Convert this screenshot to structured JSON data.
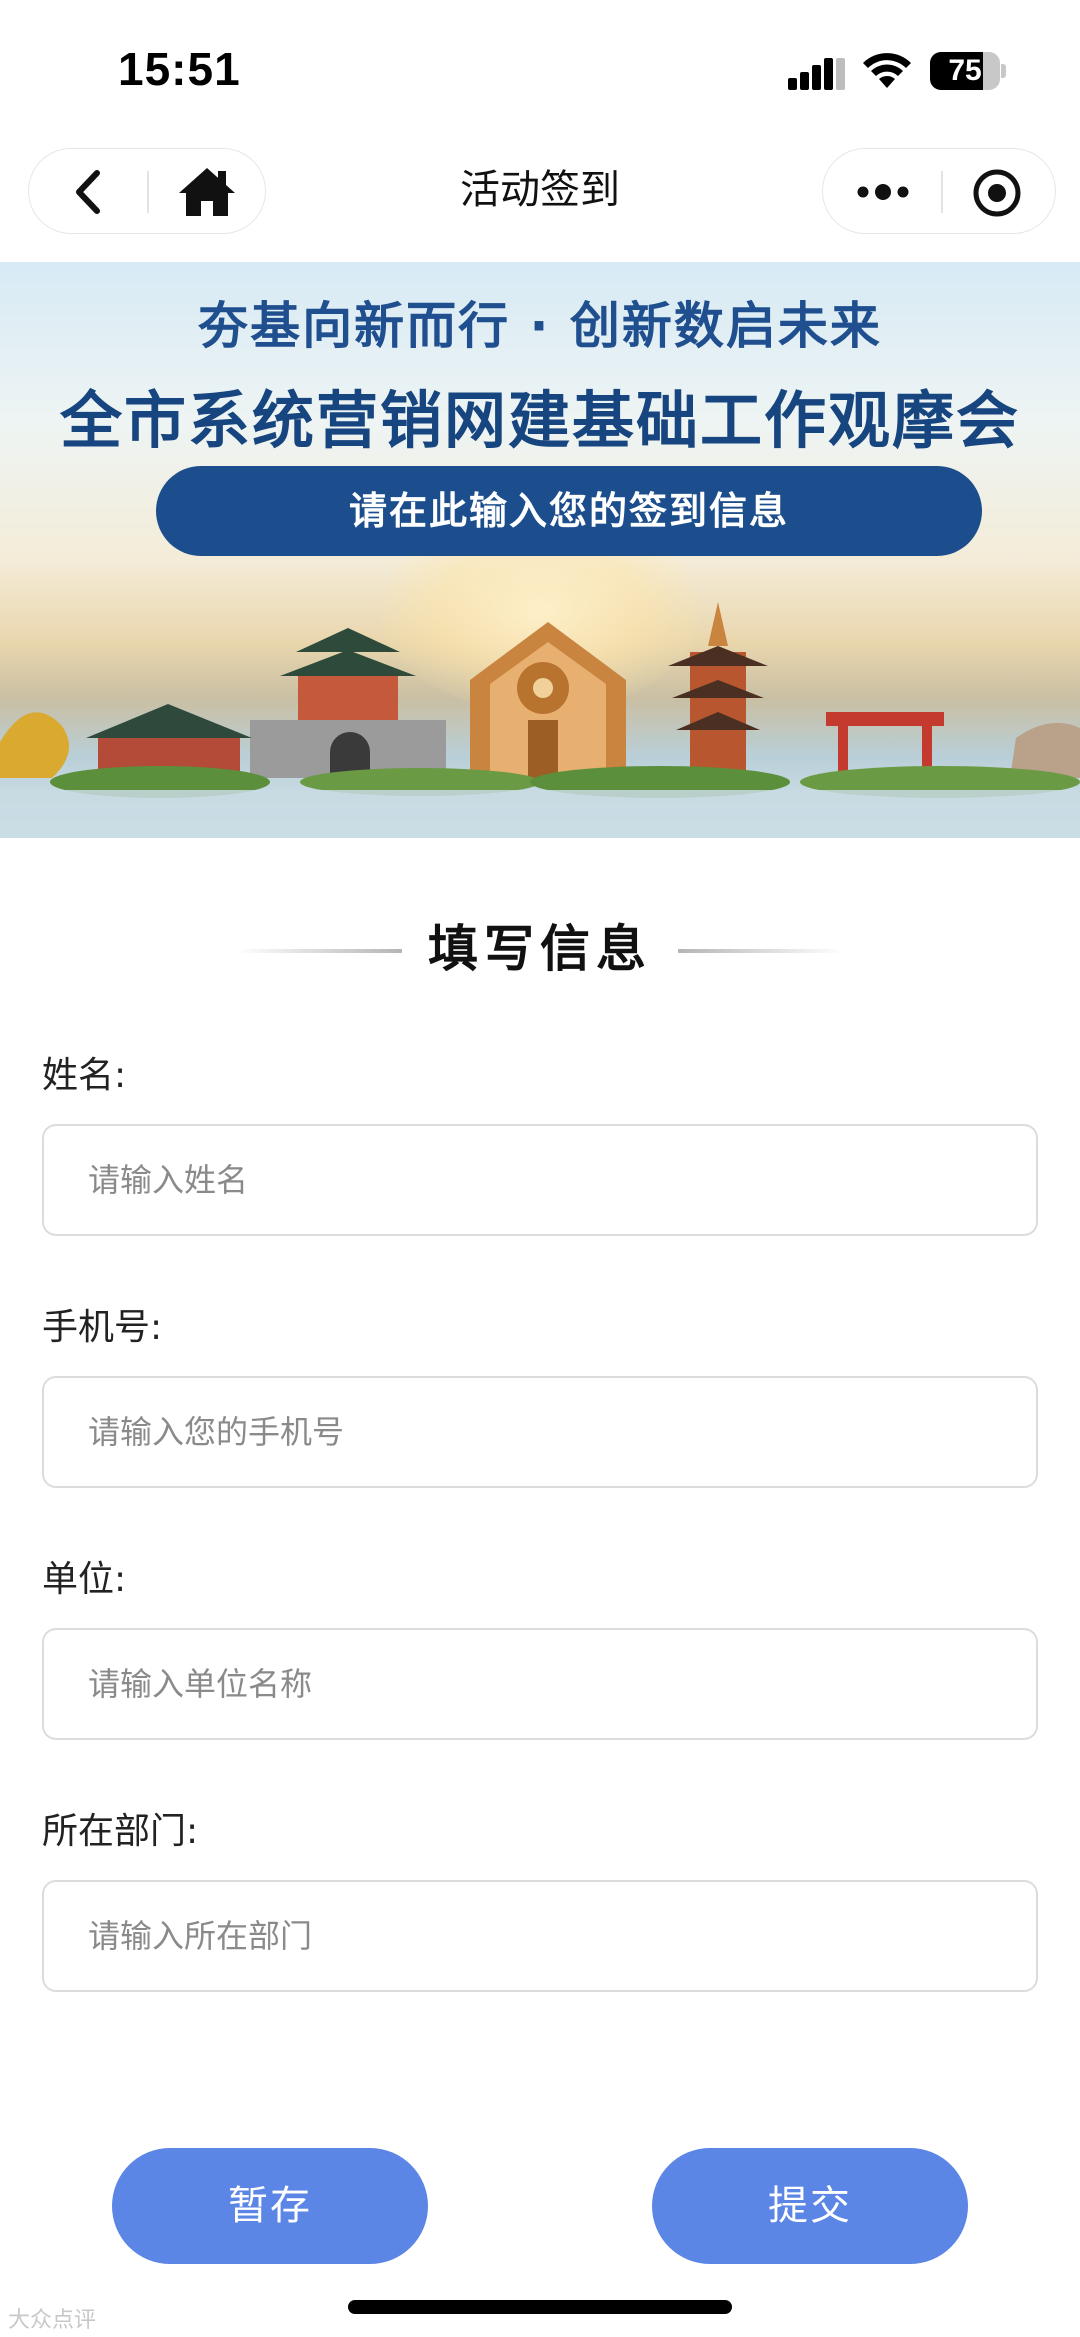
{
  "status_bar": {
    "time": "15:51",
    "battery_level": "75",
    "battery_fraction": 0.75
  },
  "nav": {
    "title": "活动签到"
  },
  "banner": {
    "subtitle": "夯基向新而行 · 创新数启未来",
    "title": "全市系统营销网建基础工作观摩会",
    "pill_text": "请在此输入您的签到信息"
  },
  "form": {
    "heading": "填写信息",
    "fields": [
      {
        "label": "姓名:",
        "placeholder": "请输入姓名"
      },
      {
        "label": "手机号:",
        "placeholder": "请输入您的手机号"
      },
      {
        "label": "单位:",
        "placeholder": "请输入单位名称"
      },
      {
        "label": "所在部门:",
        "placeholder": "请输入所在部门"
      }
    ]
  },
  "buttons": {
    "save": "暂存",
    "submit": "提交"
  },
  "colors": {
    "primary_button": "#5b86e5",
    "banner_blue": "#1c4e8d"
  },
  "watermark": "大众点评"
}
